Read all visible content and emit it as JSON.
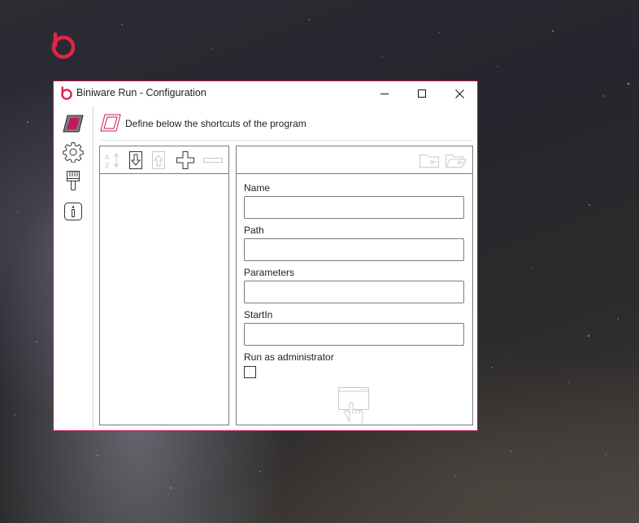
{
  "window": {
    "title": "Biniware Run - Configuration"
  },
  "header": {
    "text": "Define below the shortcuts of the program"
  },
  "sidebar": {
    "items": [
      {
        "name": "shortcuts",
        "icon": "shortcut-tile-icon"
      },
      {
        "name": "settings",
        "icon": "gear-icon"
      },
      {
        "name": "appearance",
        "icon": "paint-brush-icon"
      },
      {
        "name": "about",
        "icon": "info-icon"
      }
    ]
  },
  "list_toolbar": [
    "sort-az-icon",
    "move-down-icon",
    "move-up-icon",
    "add-icon",
    "remove-icon"
  ],
  "form_toolbar": [
    "browse-folder-icon",
    "open-folder-icon"
  ],
  "form": {
    "name_label": "Name",
    "name_value": "",
    "path_label": "Path",
    "path_value": "",
    "parameters_label": "Parameters",
    "parameters_value": "",
    "startin_label": "StartIn",
    "startin_value": "",
    "admin_label": "Run as administrator",
    "admin_checked": false
  },
  "colors": {
    "accent": "#c2185b",
    "logo_red": "#e0244a",
    "border": "#7a7a7a",
    "disabled_icon": "#c8c8c8"
  }
}
